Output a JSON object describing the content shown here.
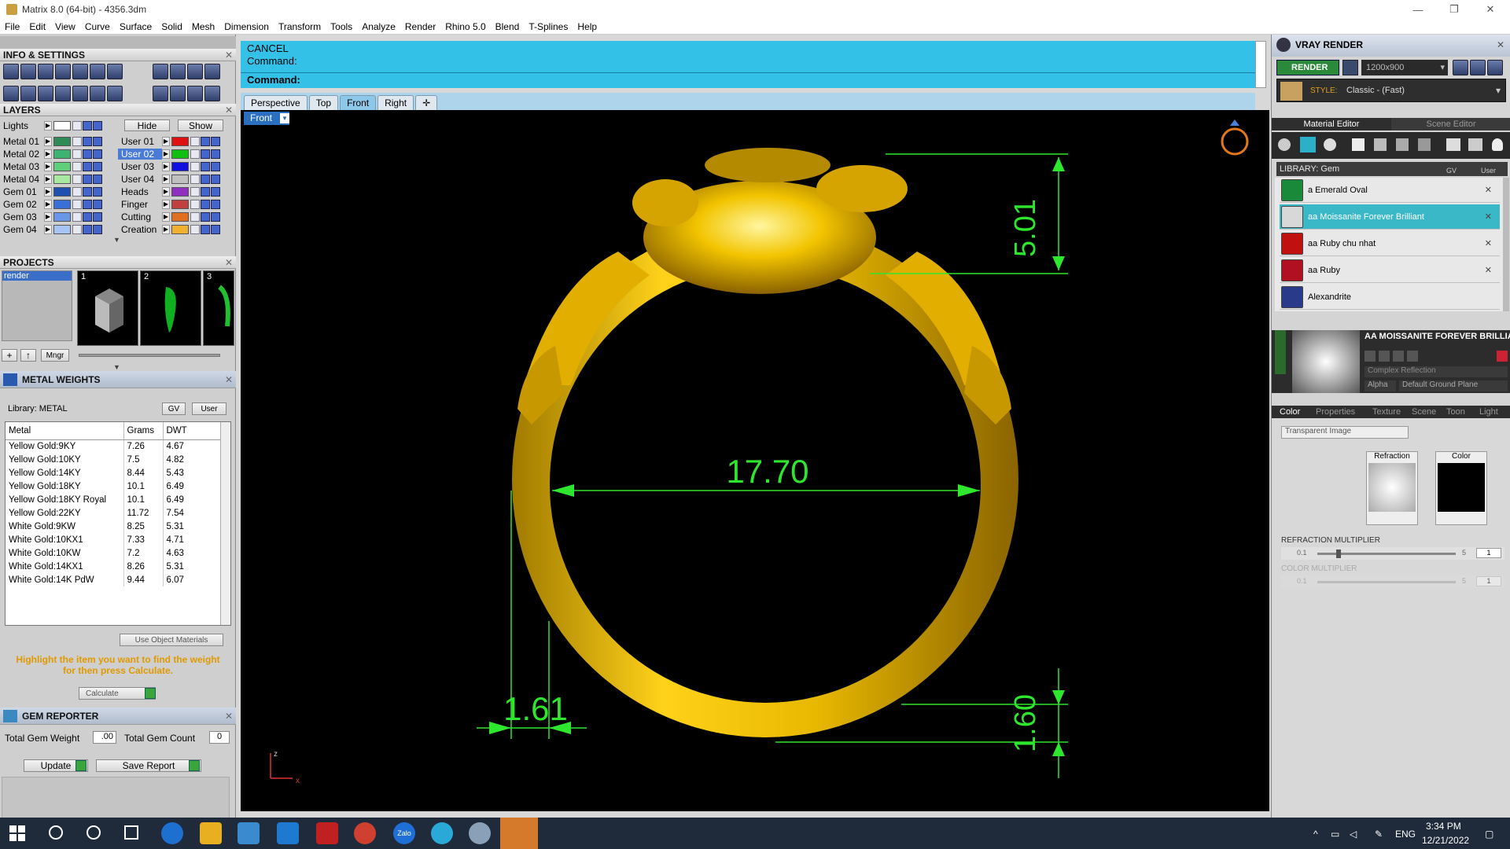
{
  "app": {
    "title": "Matrix 8.0 (64-bit) - 4356.3dm",
    "window_controls": [
      "—",
      "❐",
      "✕"
    ]
  },
  "menu": [
    "File",
    "Edit",
    "View",
    "Curve",
    "Surface",
    "Solid",
    "Mesh",
    "Dimension",
    "Transform",
    "Tools",
    "Analyze",
    "Render",
    "Rhino 5.0",
    "Blend",
    "T-Splines",
    "Help"
  ],
  "left": {
    "info_title": "INFO & SETTINGS",
    "layers_title": "LAYERS",
    "layers_lights": "Lights",
    "hide_label": "Hide",
    "show_label": "Show",
    "layers_col1": [
      {
        "name": "Metal 01",
        "color": "#2e8b57"
      },
      {
        "name": "Metal 02",
        "color": "#3cb371"
      },
      {
        "name": "Metal 03",
        "color": "#5fd07a"
      },
      {
        "name": "Metal 04",
        "color": "#a8e8a0"
      },
      {
        "name": "Gem 01",
        "color": "#1f4fb0"
      },
      {
        "name": "Gem 02",
        "color": "#3a6fd8"
      },
      {
        "name": "Gem 03",
        "color": "#6a96e8"
      },
      {
        "name": "Gem 04",
        "color": "#a8c4f4"
      }
    ],
    "layers_col2": [
      {
        "name": "User 01",
        "color": "#e01010"
      },
      {
        "name": "User 02",
        "color": "#10c010"
      },
      {
        "name": "User 03",
        "color": "#1010e0"
      },
      {
        "name": "User 04",
        "color": "#c0c0c0"
      },
      {
        "name": "Heads",
        "color": "#9030c0"
      },
      {
        "name": "Finger",
        "color": "#c04040"
      },
      {
        "name": "Cutting",
        "color": "#e07020"
      },
      {
        "name": "Creation",
        "color": "#f0b030"
      }
    ],
    "projects_title": "PROJECTS",
    "project_item": "render",
    "project_thumb_nums": [
      "1",
      "2",
      "3"
    ],
    "mngr_label": "Mngr",
    "metal_weights_title": "METAL WEIGHTS",
    "library_label": "Library: METAL",
    "gv_label": "GV",
    "user_label": "User",
    "table_headers": [
      "Metal",
      "Grams",
      "DWT"
    ],
    "table_rows": [
      [
        "Yellow Gold:9KY",
        "7.26",
        "4.67"
      ],
      [
        "Yellow Gold:10KY",
        "7.5",
        "4.82"
      ],
      [
        "Yellow Gold:14KY",
        "8.44",
        "5.43"
      ],
      [
        "Yellow Gold:18KY",
        "10.1",
        "6.49"
      ],
      [
        "Yellow Gold:18KY Royal",
        "10.1",
        "6.49"
      ],
      [
        "Yellow Gold:22KY",
        "11.72",
        "7.54"
      ],
      [
        "White Gold:9KW",
        "8.25",
        "5.31"
      ],
      [
        "White Gold:10KX1",
        "7.33",
        "4.71"
      ],
      [
        "White Gold:10KW",
        "7.2",
        "4.63"
      ],
      [
        "White Gold:14KX1",
        "8.26",
        "5.31"
      ],
      [
        "White Gold:14K PdW",
        "9.44",
        "6.07"
      ]
    ],
    "use_object_materials": "Use Object Materials",
    "hint_line1": "Highlight the item you want to find the weight",
    "hint_line2": "for then press Calculate.",
    "calculate_label": "Calculate",
    "gem_reporter_title": "GEM REPORTER",
    "total_gem_weight_label": "Total Gem Weight",
    "total_gem_weight_value": ".00",
    "total_gem_count_label": "Total Gem Count",
    "total_gem_count_value": "0",
    "update_label": "Update",
    "save_report_label": "Save Report"
  },
  "command": {
    "line1": "CANCEL",
    "line2": "Command:",
    "prompt": "Command:"
  },
  "view_tabs": [
    "Perspective",
    "Top",
    "Front",
    "Right"
  ],
  "active_tab": "Front",
  "viewport": {
    "label": "Front",
    "dim_top": "5.01",
    "dim_width": "17.70",
    "dim_bottom_left": "1.61",
    "dim_bottom_right": "1.60",
    "axis_z": "z",
    "axis_x": "x"
  },
  "right": {
    "title": "VRAY RENDER",
    "render_label": "RENDER",
    "resolution": "1200x900",
    "style_label": "STYLE:",
    "style_value": "Classic - (Fast)",
    "tab_material": "Material Editor",
    "tab_scene": "Scene Editor",
    "library_label": "LIBRARY: Gem",
    "gv_label": "GV",
    "user_label": "User",
    "library_items": [
      {
        "name": "a Emerald Oval",
        "color": "#1a8a3a"
      },
      {
        "name": "aa Moissanite Forever Brilliant",
        "color": "#d8d8d8"
      },
      {
        "name": "aa Ruby chu nhat",
        "color": "#c01010"
      },
      {
        "name": "aa Ruby",
        "color": "#b01020"
      },
      {
        "name": "Alexandrite",
        "color": "#2a3a8a"
      }
    ],
    "selected_name": "AA MOISSANITE FOREVER BRILLIANT",
    "reflection_dropdown": "Complex Reflection",
    "alpha_label": "Alpha",
    "ground_label": "Default Ground Plane",
    "subtabs": [
      "Color",
      "Properties",
      "Texture",
      "Scene",
      "Toon",
      "Light"
    ],
    "transparent_dropdown": "Transparent Image",
    "refraction_label": "Refraction",
    "color_label": "Color",
    "refr_mult_title": "REFRACTION MULTIPLIER",
    "refr_min": "0.1",
    "refr_max": "5",
    "refr_value": "1",
    "color_mult_title": "COLOR MULTIPLIER",
    "color_min": "0.1",
    "color_max": "5",
    "color_value": "1"
  },
  "taskbar": {
    "lang": "ENG",
    "time": "3:34 PM",
    "date": "12/21/2022",
    "zalo": "Zalo"
  }
}
